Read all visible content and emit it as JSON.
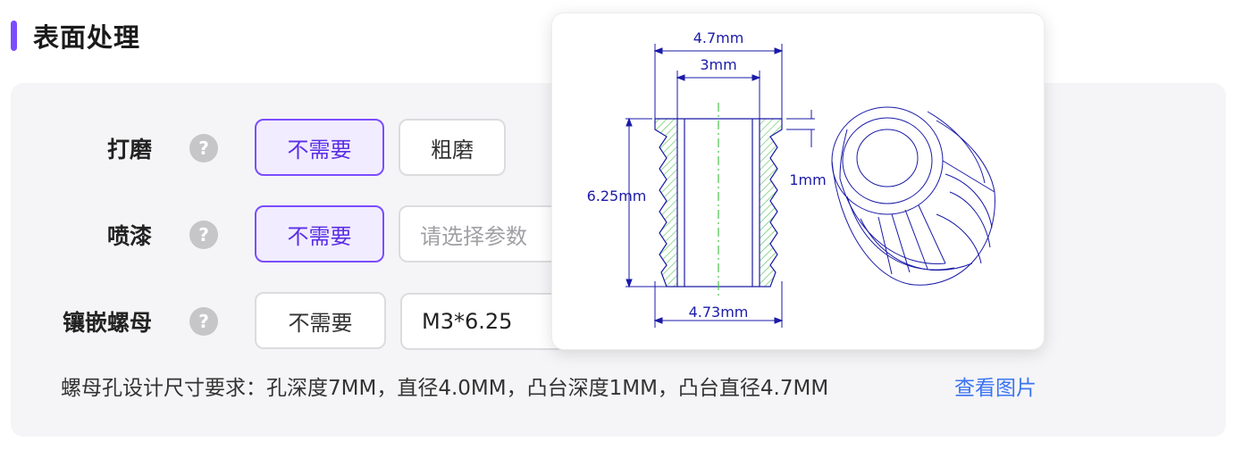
{
  "section": {
    "title": "表面处理"
  },
  "rows": [
    {
      "label": "打磨",
      "options": [
        "不需要",
        "粗磨"
      ],
      "selected": "不需要"
    },
    {
      "label": "喷漆",
      "option": "不需要",
      "select_placeholder": "请选择参数",
      "selected": "不需要"
    },
    {
      "label": "镶嵌螺母",
      "option": "不需要",
      "select_value": "M3*6.25"
    }
  ],
  "note": "螺母孔设计尺寸要求：孔深度7MM，直径4.0MM，凸台深度1MM，凸台直径4.7MM",
  "link": "查看图片",
  "diagram": {
    "dims": {
      "top_outer": "4.7mm",
      "top_inner": "3mm",
      "height": "6.25mm",
      "flange": "1mm",
      "bottom": "4.73mm"
    }
  },
  "colors": {
    "accent": "#7b4dff",
    "link": "#3b74f2",
    "drawing": "#1a1aa8",
    "hatch": "#4cc24c"
  }
}
